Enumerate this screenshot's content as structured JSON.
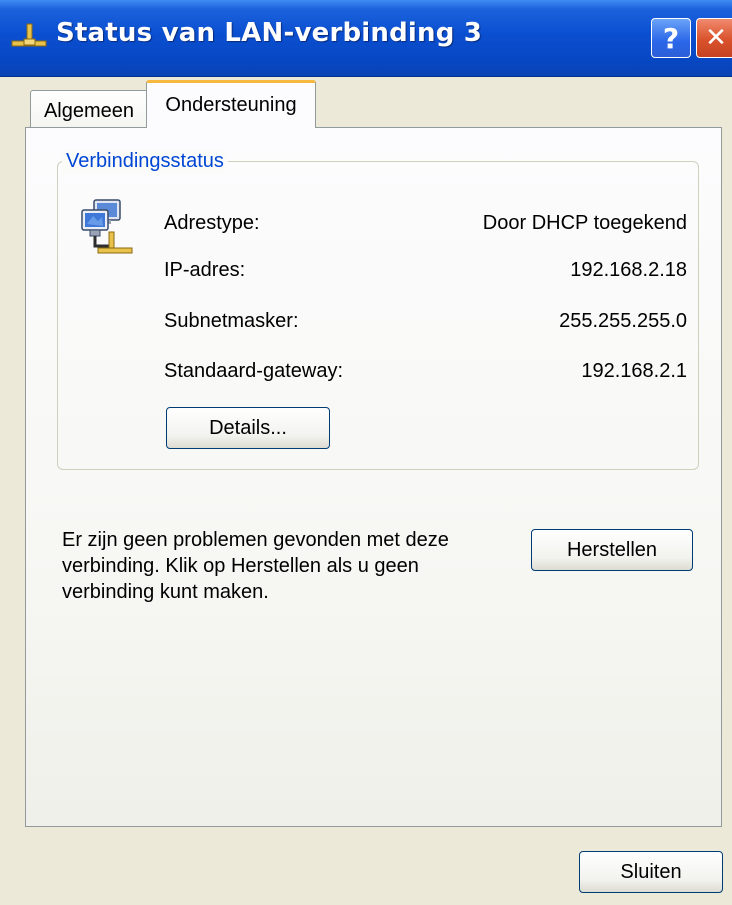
{
  "window": {
    "title": "Status van LAN-verbinding 3",
    "help_label": "?",
    "close_label": "✕"
  },
  "tabs": [
    {
      "label": "Algemeen",
      "active": false
    },
    {
      "label": "Ondersteuning",
      "active": true
    }
  ],
  "connection_status": {
    "legend": "Verbindingsstatus",
    "rows": [
      {
        "label": "Adrestype:",
        "value": "Door DHCP toegekend"
      },
      {
        "label": "IP-adres:",
        "value": "192.168.2.18"
      },
      {
        "label": "Subnetmasker:",
        "value": "255.255.255.0"
      },
      {
        "label": "Standaard-gateway:",
        "value": "192.168.2.1"
      }
    ],
    "details_button": "Details..."
  },
  "repair": {
    "message_lines": [
      "Er zijn geen problemen gevonden met deze",
      "verbinding. Klik op Herstellen als u geen",
      "verbinding kunt maken."
    ],
    "button": "Herstellen"
  },
  "footer": {
    "close_button": "Sluiten"
  },
  "icons": {
    "title": "network-connection-icon",
    "status": "network-computers-icon"
  },
  "colors": {
    "titlebar": "#0a4fd0",
    "accent_tab": "#f7b83f",
    "legend_text": "#0046d5",
    "window_bg": "#ece9d8"
  }
}
